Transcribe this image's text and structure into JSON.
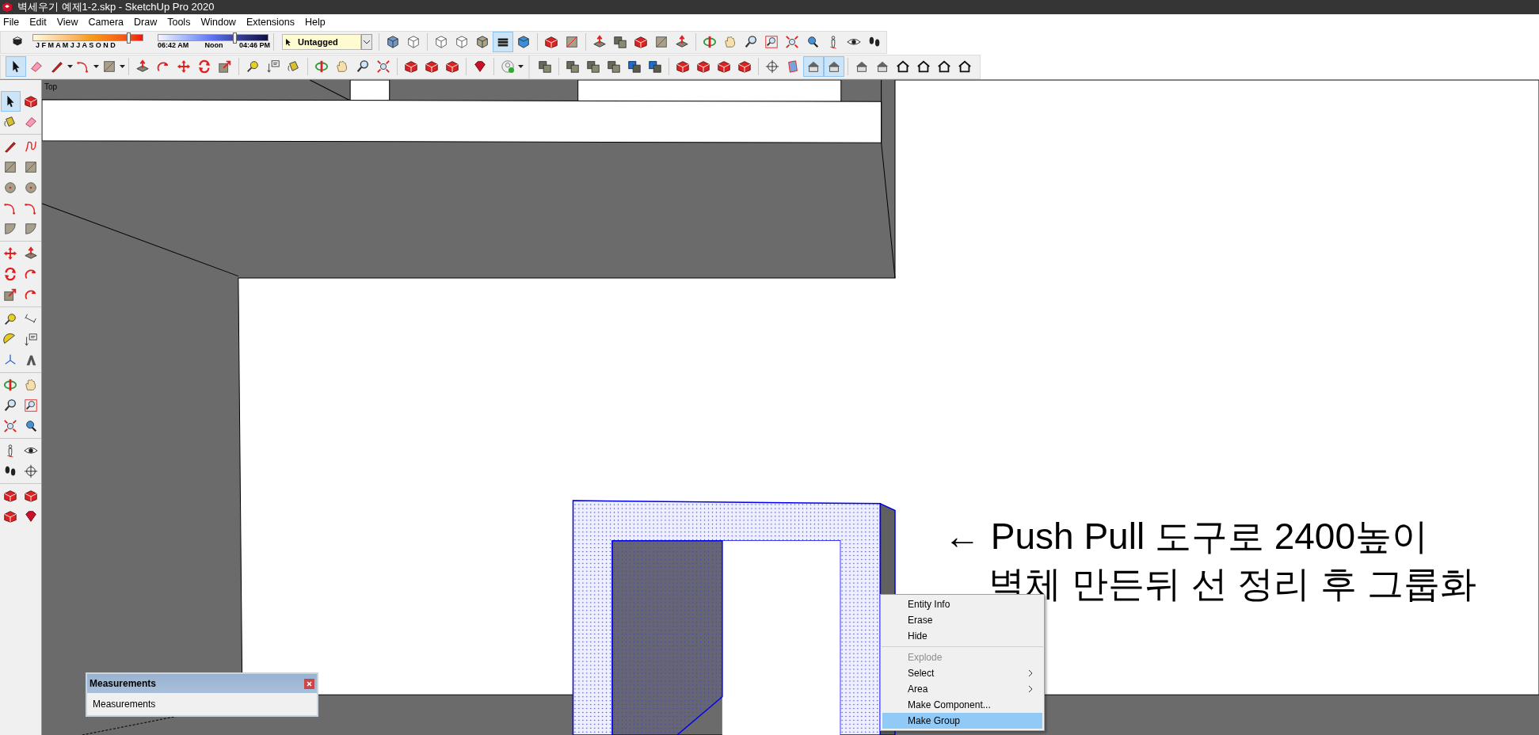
{
  "window": {
    "title": "벽세우기 예제1-2.skp - SketchUp Pro 2020"
  },
  "menu": [
    "File",
    "Edit",
    "View",
    "Camera",
    "Draw",
    "Tools",
    "Window",
    "Extensions",
    "Help"
  ],
  "shadows": {
    "months": "J F M A M J J A S O N D",
    "month_slider": {
      "level": 0.88
    },
    "sunrise": "06:42 AM",
    "noon": "Noon",
    "sunset": "04:46 PM",
    "time_slider": {
      "level": 0.7
    }
  },
  "tag_dropdown": {
    "value": "Untagged"
  },
  "toolbar_1": [
    {
      "selected": false
    },
    {
      "selected": false
    },
    {
      "selected": false
    },
    {
      "selected": false
    },
    {
      "selected": false
    },
    {
      "selected": false
    },
    {
      "selected": true
    },
    {
      "selected": false
    },
    {
      "selected": false
    },
    {
      "selected": false
    },
    {
      "selected": false
    },
    {
      "selected": false
    },
    {
      "selected": false
    },
    {
      "selected": false
    },
    {
      "selected": false
    },
    {
      "selected": false
    },
    {
      "selected": false
    },
    {
      "selected": false
    },
    {
      "selected": false
    },
    {
      "selected": false
    },
    {
      "selected": false
    },
    {
      "selected": false
    },
    {
      "selected": false
    },
    {
      "selected": false
    }
  ],
  "toolbar_2": [
    {
      "selected": true
    },
    {
      "selected": false
    },
    {
      "selected": false
    },
    {
      "selected": false
    },
    {
      "selected": false
    },
    {
      "selected": false
    },
    {
      "selected": false
    },
    {
      "selected": false
    },
    {
      "selected": false
    },
    {
      "selected": false
    },
    {
      "selected": false
    },
    {
      "selected": false
    },
    {
      "selected": false
    },
    {
      "selected": false
    },
    {
      "selected": false
    },
    {
      "selected": false
    },
    {
      "selected": false
    },
    {
      "selected": false
    },
    {
      "selected": false
    },
    {
      "selected": false
    },
    {
      "selected": false
    },
    {
      "selected": false
    }
  ],
  "toolbar_3": [
    {
      "selected": false
    },
    {
      "selected": false
    },
    {
      "selected": false
    },
    {
      "selected": false
    },
    {
      "selected": false
    },
    {
      "selected": false
    },
    {
      "selected": false
    },
    {
      "selected": false
    },
    {
      "selected": false
    },
    {
      "selected": false
    },
    {
      "selected": false
    },
    {
      "selected": false
    },
    {
      "selected": true
    },
    {
      "selected": true
    },
    {
      "selected": false
    },
    {
      "selected": false
    },
    {
      "selected": false
    },
    {
      "selected": false
    },
    {
      "selected": false
    },
    {
      "selected": false
    }
  ],
  "left_toolbar": [
    {
      "selected": true
    },
    {
      "selected": false
    },
    {
      "selected": false
    },
    {
      "selected": false
    },
    {
      "selected": false
    },
    {
      "selected": false
    },
    {
      "selected": false
    },
    {
      "selected": false
    },
    {
      "selected": false
    },
    {
      "selected": false
    },
    {
      "selected": false
    },
    {
      "selected": false
    },
    {
      "selected": false
    },
    {
      "selected": false
    },
    {
      "selected": false
    },
    {
      "selected": false
    },
    {
      "selected": false
    },
    {
      "selected": false
    },
    {
      "selected": false
    },
    {
      "selected": false
    },
    {
      "selected": false
    },
    {
      "selected": false
    },
    {
      "selected": false
    },
    {
      "selected": false
    },
    {
      "selected": false
    },
    {
      "selected": false
    },
    {
      "selected": false
    },
    {
      "selected": false
    },
    {
      "selected": false
    },
    {
      "selected": false
    },
    {
      "selected": false
    },
    {
      "selected": false
    },
    {
      "selected": false
    },
    {
      "selected": false
    },
    {
      "selected": false
    },
    {
      "selected": false
    },
    {
      "selected": false
    },
    {
      "selected": false
    },
    {
      "selected": false
    },
    {
      "selected": false
    }
  ],
  "viewport": {
    "view_label": "Top"
  },
  "annotation": {
    "lines": [
      "← Push Pull 도구로 2400높이",
      "벽체 만든뒤 선 정리 후 그룹화"
    ]
  },
  "context_menu": {
    "items": [
      {
        "kind": "item",
        "label": "Entity Info",
        "disabled": false,
        "submenu": false,
        "selected": false
      },
      {
        "kind": "item",
        "label": "Erase",
        "disabled": false,
        "submenu": false,
        "selected": false
      },
      {
        "kind": "item",
        "label": "Hide",
        "disabled": false,
        "submenu": false,
        "selected": false
      },
      {
        "kind": "separator"
      },
      {
        "kind": "item",
        "label": "Explode",
        "disabled": true,
        "submenu": false,
        "selected": false
      },
      {
        "kind": "item",
        "label": "Select",
        "disabled": false,
        "submenu": true,
        "selected": false
      },
      {
        "kind": "item",
        "label": "Area",
        "disabled": false,
        "submenu": true,
        "selected": false
      },
      {
        "kind": "item",
        "label": "Make Component...",
        "disabled": false,
        "submenu": false,
        "selected": false
      },
      {
        "kind": "item",
        "label": "Make Group",
        "disabled": false,
        "submenu": false,
        "selected": true
      }
    ]
  },
  "measurements": {
    "title": "Measurements",
    "label": "Measurements"
  }
}
